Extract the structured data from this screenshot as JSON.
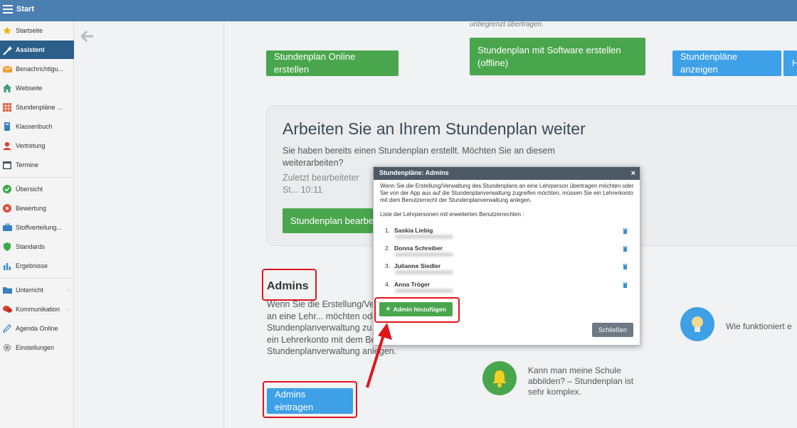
{
  "app": {
    "title": "Start"
  },
  "sidebar": {
    "items": [
      {
        "label": "Startseite",
        "icon": "star-icon",
        "color": "#f0b400"
      },
      {
        "label": "Assistent",
        "icon": "magic-wand-icon",
        "color": "#ffffff",
        "active": true
      },
      {
        "label": "Benachrichtigu...",
        "icon": "mail-icon",
        "color": "#f0a030"
      },
      {
        "label": "Webseite",
        "icon": "home-icon",
        "color": "#3aa070"
      },
      {
        "label": "Stundenpläne ...",
        "icon": "grid-icon",
        "color": "#e05a3a"
      },
      {
        "label": "Klassenbuch",
        "icon": "book-icon",
        "color": "#3a7fc0"
      },
      {
        "label": "Vertretung",
        "icon": "person-icon",
        "color": "#e04030"
      },
      {
        "label": "Termine",
        "icon": "calendar-icon",
        "color": "#445566"
      },
      {
        "label": "Übersicht",
        "icon": "check-circle-icon",
        "color": "#3aaa4a"
      },
      {
        "label": "Bewertung",
        "icon": "rating-icon",
        "color": "#e05040"
      },
      {
        "label": "Stoffverteilung...",
        "icon": "briefcase-icon",
        "color": "#3a7fc0"
      },
      {
        "label": "Standards",
        "icon": "shield-icon",
        "color": "#3aaa4a"
      },
      {
        "label": "Ergebnisse",
        "icon": "bar-chart-icon",
        "color": "#3a8fd0"
      },
      {
        "label": "Unterricht",
        "icon": "folder-icon",
        "color": "#3a7fc0",
        "chevron": true
      },
      {
        "label": "Kommunikation",
        "icon": "chat-icon",
        "color": "#e04030",
        "chevron": true
      },
      {
        "label": "Agenda Online",
        "icon": "pencil-icon",
        "color": "#3a7fc0"
      },
      {
        "label": "Einstellungen",
        "icon": "gear-icon",
        "color": "#888888"
      }
    ]
  },
  "main": {
    "top_note": "unbegrenzt übertragen.",
    "btn_online": "Stundenplan Online erstellen",
    "btn_software": "Stundenplan mit Software erstellen (offline)",
    "btn_show": "Stundenpläne anzeigen",
    "btn_cut": "H",
    "card_title": "Arbeiten Sie an Ihrem Stundenplan weiter",
    "card_text": "Sie haben bereits einen Stundenplan erstellt. Möchten Sie an diesem weiterarbeiten?",
    "card_meta": "Zuletzt bearbeiteter St... 10:11",
    "btn_edit": "Stundenplan bearbe",
    "admins_title": "Admins",
    "admins_text": "Wenn Sie die Erstellung/Ve... Stundenplans an eine Lehr... möchten oder Sie von der ... Stundenplanverwaltung zu... müssen Sie ein Lehrerkonto mit dem Benutzerrecht der Stundenplanverwaltung anlegen.",
    "btn_admins": "Admins eintragen",
    "faq1": "Kann man meine Schule abbilden? – Stundenplan ist sehr komplex.",
    "faq2": "Wie funktioniert e"
  },
  "modal": {
    "title": "Stundenpläne: Admins",
    "text": "Wenn Sie die Erstellung/Verwaltung des Stundenplans an eine Lehrperson übertragen möchten oder Sie von der App aus auf die Stundenplanverwaltung zugreifen möchten, müssen Sie ein Lehrerkonto mit dem Benutzerrecht der Stundenplanverwaltung anlegen.",
    "list_title": "Liste der Lehrpersonen mit erweiterten Benutzerrechten :",
    "admins": [
      {
        "num": "1.",
        "name": "Saskia Liebig"
      },
      {
        "num": "2.",
        "name": "Donna Schreiber"
      },
      {
        "num": "3.",
        "name": "Julianne Siedler"
      },
      {
        "num": "4.",
        "name": "Anna Tröger"
      }
    ],
    "add_btn": "Admin hinzufügen",
    "close_btn": "Schließen",
    "close_x": "×"
  },
  "colors": {
    "topbar": "#4a7fb0",
    "sidebar_active": "#2c5e8a",
    "green": "#4aa64d",
    "blue": "#3ea0e6",
    "highlight": "#e0161b"
  }
}
